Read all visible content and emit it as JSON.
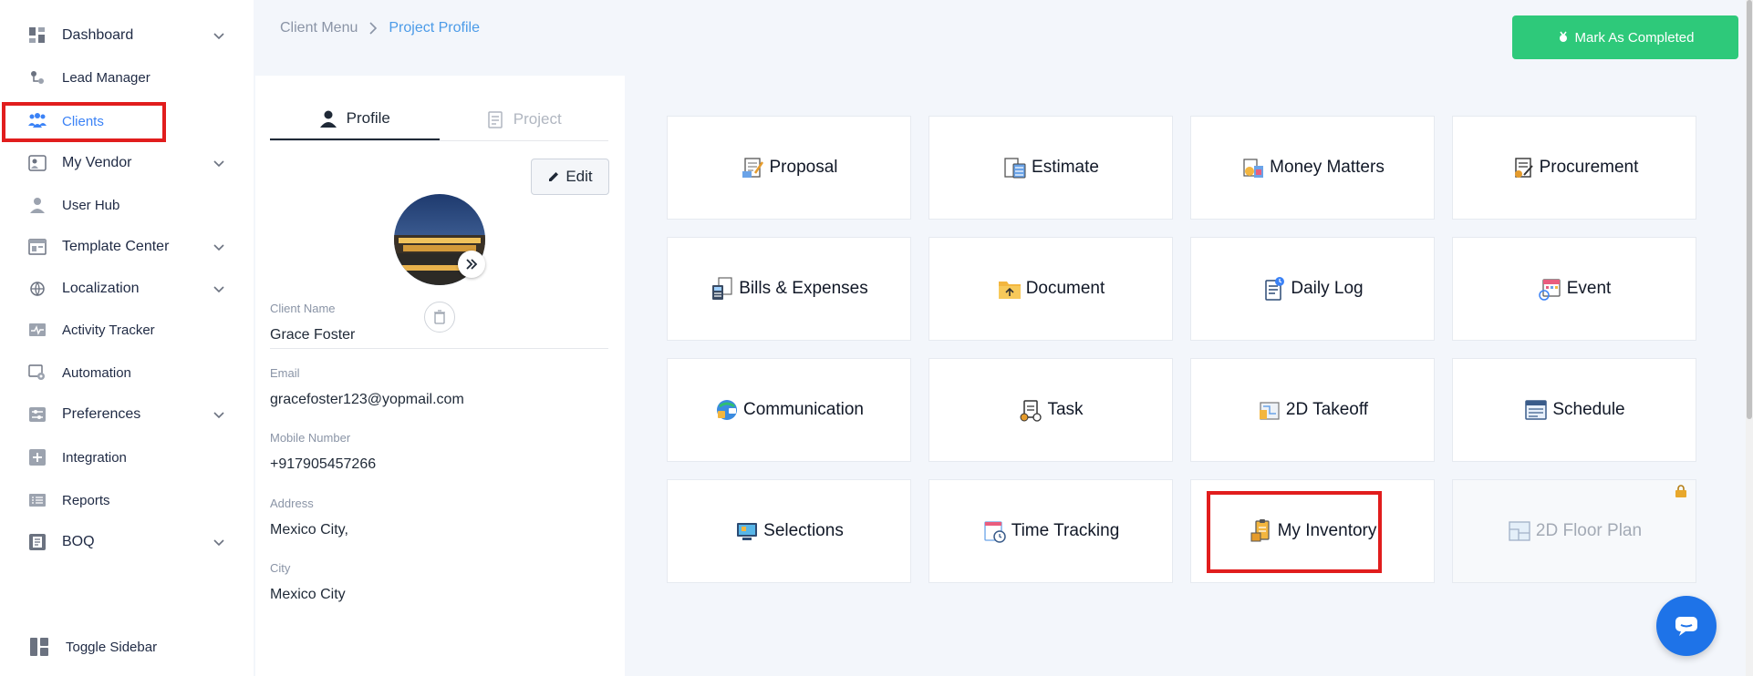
{
  "sidebar": {
    "items": [
      {
        "label": "Dashboard",
        "icon": "dashboard-icon",
        "has_chevron": true
      },
      {
        "label": "Lead Manager",
        "icon": "lead-manager-icon",
        "has_chevron": false
      },
      {
        "label": "Clients",
        "icon": "clients-icon",
        "has_chevron": false,
        "active": true
      },
      {
        "label": "My Vendor",
        "icon": "vendor-icon",
        "has_chevron": true
      },
      {
        "label": "User Hub",
        "icon": "user-icon",
        "has_chevron": false
      },
      {
        "label": "Template Center",
        "icon": "template-icon",
        "has_chevron": true
      },
      {
        "label": "Localization",
        "icon": "localization-icon",
        "has_chevron": true
      },
      {
        "label": "Activity Tracker",
        "icon": "activity-icon",
        "has_chevron": false
      },
      {
        "label": "Automation",
        "icon": "automation-icon",
        "has_chevron": false
      },
      {
        "label": "Preferences",
        "icon": "preferences-icon",
        "has_chevron": true
      },
      {
        "label": "Integration",
        "icon": "integration-icon",
        "has_chevron": false
      },
      {
        "label": "Reports",
        "icon": "reports-icon",
        "has_chevron": false
      },
      {
        "label": "BOQ",
        "icon": "boq-icon",
        "has_chevron": true
      }
    ],
    "toggle_label": "Toggle Sidebar"
  },
  "breadcrumb": {
    "parent": "Client Menu",
    "current": "Project Profile"
  },
  "header": {
    "complete_label": "Mark As Completed"
  },
  "profile": {
    "tabs": [
      {
        "label": "Profile",
        "active": true
      },
      {
        "label": "Project",
        "active": false
      }
    ],
    "edit_label": "Edit",
    "fields": [
      {
        "label": "Client Name",
        "value": "Grace Foster"
      },
      {
        "label": "Email",
        "value": "gracefoster123@yopmail.com"
      },
      {
        "label": "Mobile Number",
        "value": "+917905457266"
      },
      {
        "label": "Address",
        "value": "Mexico City,"
      },
      {
        "label": "City",
        "value": "Mexico City"
      }
    ]
  },
  "modules": [
    {
      "label": "Proposal",
      "icon": "proposal-icon"
    },
    {
      "label": "Estimate",
      "icon": "estimate-icon"
    },
    {
      "label": "Money Matters",
      "icon": "money-matters-icon"
    },
    {
      "label": "Procurement",
      "icon": "procurement-icon"
    },
    {
      "label": "Bills & Expenses",
      "icon": "bills-icon"
    },
    {
      "label": "Document",
      "icon": "document-icon"
    },
    {
      "label": "Daily Log",
      "icon": "daily-log-icon"
    },
    {
      "label": "Event",
      "icon": "event-icon"
    },
    {
      "label": "Communication",
      "icon": "communication-icon"
    },
    {
      "label": "Task",
      "icon": "task-icon"
    },
    {
      "label": "2D Takeoff",
      "icon": "takeoff-icon"
    },
    {
      "label": "Schedule",
      "icon": "schedule-icon"
    },
    {
      "label": "Selections",
      "icon": "selections-icon"
    },
    {
      "label": "Time Tracking",
      "icon": "time-tracking-icon"
    },
    {
      "label": "My Inventory",
      "icon": "inventory-icon"
    },
    {
      "label": "2D Floor Plan",
      "icon": "floor-plan-icon",
      "locked": true
    }
  ],
  "colors": {
    "accent": "#3b82f6",
    "success": "#2ec97a",
    "highlight": "#e11d1d",
    "chat": "#1e73e8"
  }
}
